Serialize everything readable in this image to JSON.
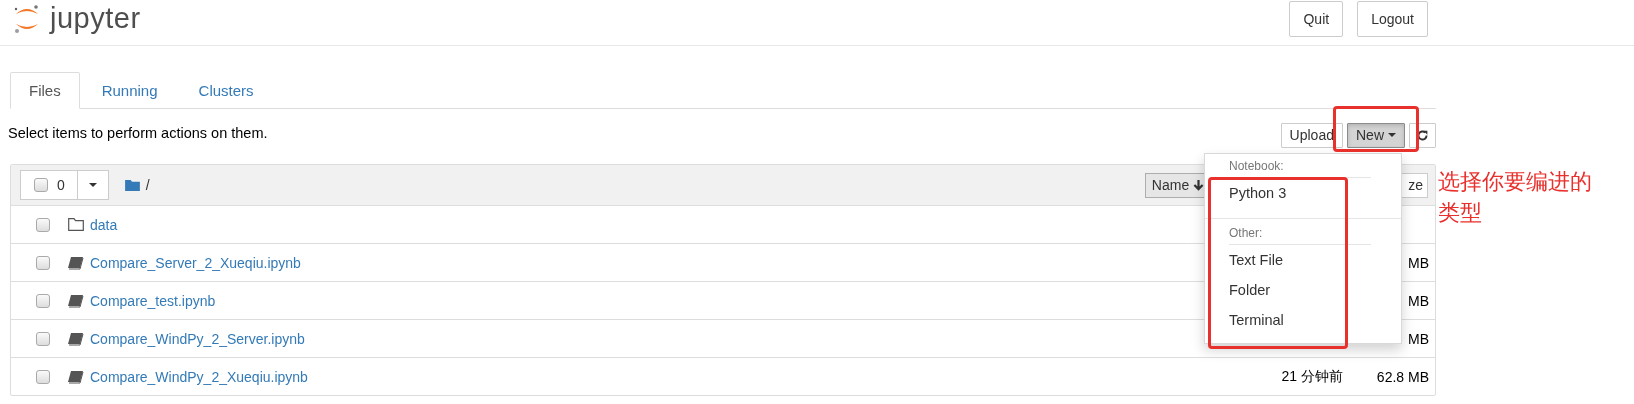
{
  "header": {
    "logo_text": "jupyter",
    "buttons": [
      "Quit",
      "Logout"
    ]
  },
  "tabs": [
    {
      "label": "Files",
      "selected": true
    },
    {
      "label": "Running",
      "selected": false
    },
    {
      "label": "Clusters",
      "selected": false
    }
  ],
  "hint": "Select items to perform actions on them.",
  "actions": [
    {
      "label": "Upload",
      "kind": "button",
      "pressed": false
    },
    {
      "label": "New",
      "kind": "dropdown",
      "pressed": true
    },
    {
      "kind": "refresh",
      "pressed": false
    }
  ],
  "list_header": {
    "select_all_checked": false,
    "selected_count": "0",
    "breadcrumb": "/",
    "sort_label": "Name",
    "column_3": "ze"
  },
  "files": [
    {
      "kind": "folder",
      "name": "data",
      "checked": false
    },
    {
      "kind": "notebook",
      "name": "Compare_Server_2_Xueqiu.ipynb",
      "checked": false,
      "size": "MB"
    },
    {
      "kind": "notebook",
      "name": "Compare_test.ipynb",
      "checked": false,
      "size": "MB"
    },
    {
      "kind": "notebook",
      "name": "Compare_WindPy_2_Server.ipynb",
      "checked": false,
      "size": "MB"
    },
    {
      "kind": "notebook",
      "name": "Compare_WindPy_2_Xueqiu.ipynb",
      "checked": false,
      "modified": "21 分钟前",
      "size": "62.8 MB"
    }
  ],
  "new_menu": {
    "sections": [
      {
        "header": "Notebook:",
        "items": [
          "Python 3"
        ]
      },
      {
        "header": "Other:",
        "items": [
          "Text File",
          "Folder",
          "Terminal"
        ]
      }
    ]
  },
  "annotation": "选择你要编进的类型"
}
